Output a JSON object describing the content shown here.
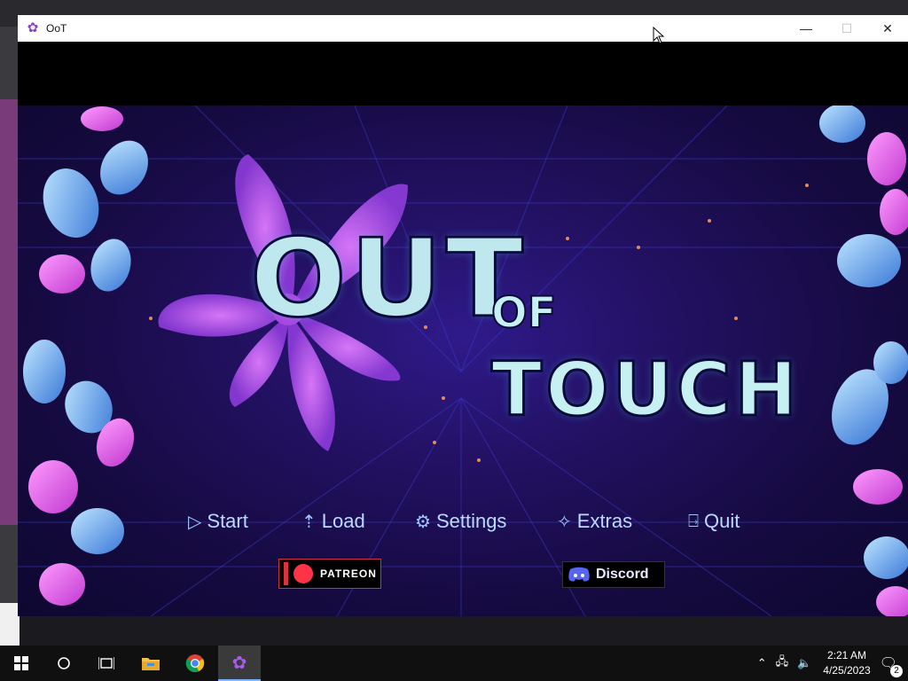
{
  "window": {
    "title": "OoT",
    "controls": {
      "minimize": "—",
      "maximize": "☐",
      "close": "✕"
    }
  },
  "game": {
    "logo": {
      "line1": "OUT",
      "line2": "OF",
      "line3": "TOUCH"
    },
    "menu": [
      {
        "icon": "▷",
        "label": "Start"
      },
      {
        "icon": "⇡",
        "label": "Load"
      },
      {
        "icon": "⚙",
        "label": "Settings"
      },
      {
        "icon": "✧",
        "label": "Extras"
      },
      {
        "icon": "⍈",
        "label": "Quit"
      }
    ],
    "social": {
      "patreon": "PATREON",
      "discord": "Discord"
    },
    "colors": {
      "accent": "#bfe8ee",
      "menu_text": "#bcd9ff",
      "patreon_red": "#ff3347",
      "bg_deep": "#150a3f"
    }
  },
  "taskbar": {
    "apps": [
      {
        "name": "start",
        "icon": "windows-icon"
      },
      {
        "name": "search",
        "icon": "search-circle-icon"
      },
      {
        "name": "task-view",
        "icon": "task-view-icon"
      },
      {
        "name": "file-explorer",
        "icon": "folder-icon"
      },
      {
        "name": "chrome",
        "icon": "chrome-icon"
      },
      {
        "name": "oot",
        "icon": "flower-icon"
      }
    ],
    "clock": {
      "time": "2:21 AM",
      "date": "4/25/2023"
    },
    "notifications": "2"
  }
}
